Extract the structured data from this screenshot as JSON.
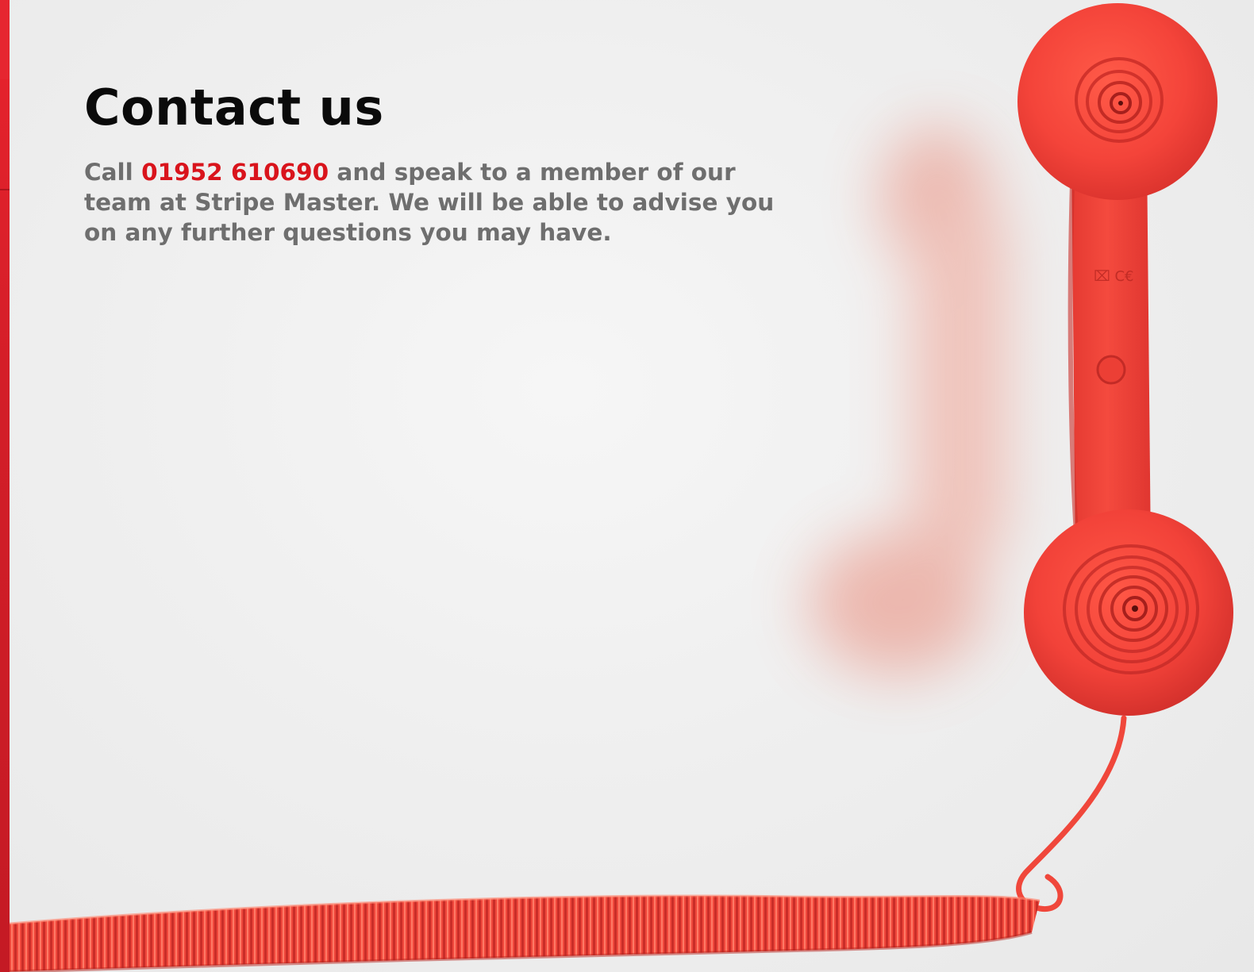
{
  "page": {
    "title": "Contact us",
    "lead_prefix": "Call",
    "phone": "01952 610690",
    "lead_suffix": "and speak to a member of our team at Stripe Master. We will be able to advise you on any further questions you may have."
  },
  "colors": {
    "accent": "#d9141c",
    "title": "#0a0a0a",
    "body_text": "#6e6e6e",
    "telephone": "#f24a3c"
  },
  "icons": {
    "hero_image": "red-telephone-handset-image"
  }
}
